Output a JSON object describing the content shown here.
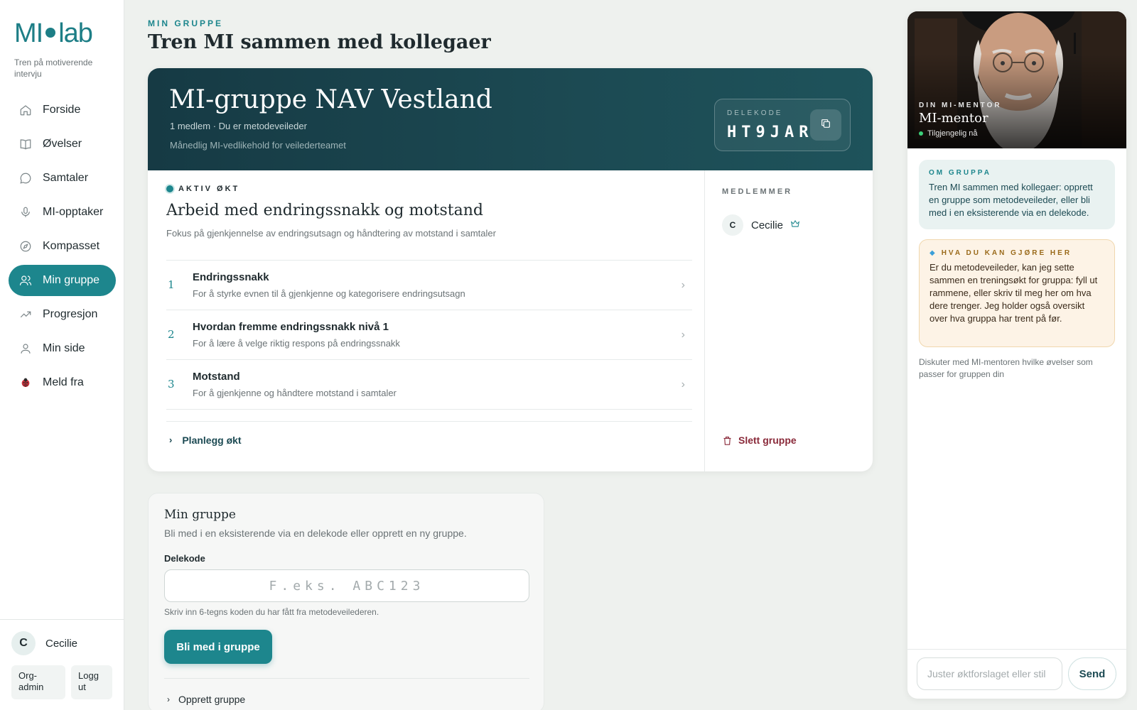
{
  "brand": {
    "logo_left": "MI",
    "logo_right": "lab",
    "tagline": "Tren på motiverende intervju"
  },
  "nav": {
    "items": [
      {
        "label": "Forside",
        "icon": "home-icon"
      },
      {
        "label": "Øvelser",
        "icon": "book-icon"
      },
      {
        "label": "Samtaler",
        "icon": "chat-icon"
      },
      {
        "label": "MI-opptaker",
        "icon": "microphone-icon"
      },
      {
        "label": "Kompasset",
        "icon": "compass-icon"
      },
      {
        "label": "Min gruppe",
        "icon": "users-icon",
        "active": true
      },
      {
        "label": "Progresjon",
        "icon": "trend-icon"
      },
      {
        "label": "Min side",
        "icon": "user-icon"
      },
      {
        "label": "Meld fra",
        "icon": "ladybug-icon"
      }
    ]
  },
  "user": {
    "initial": "C",
    "name": "Cecilie",
    "org_admin": "Org-admin",
    "logout": "Logg ut"
  },
  "header": {
    "eyebrow": "MIN GRUPPE",
    "title": "Tren MI sammen med kollegaer"
  },
  "group": {
    "name": "MI-gruppe NAV Vestland",
    "meta": "1 medlem · Du er metodeveileder",
    "description": "Månedlig MI-vedlikehold for veilederteamet",
    "code_label": "DELEKODE",
    "code": "HT9JAR"
  },
  "session": {
    "tag": "AKTIV ØKT",
    "title": "Arbeid med endringssnakk og motstand",
    "description": "Fokus på gjenkjennelse av endringsutsagn og håndtering av motstand i samtaler",
    "exercises": [
      {
        "num": "1",
        "title": "Endringssnakk",
        "subtitle": "For å styrke evnen til å gjenkjenne og kategorisere endringsutsagn"
      },
      {
        "num": "2",
        "title": "Hvordan fremme endringssnakk nivå 1",
        "subtitle": "For å lære å velge riktig respons på endringssnakk"
      },
      {
        "num": "3",
        "title": "Motstand",
        "subtitle": "For å gjenkjenne og håndtere motstand i samtaler"
      }
    ],
    "plan_label": "Planlegg økt"
  },
  "members": {
    "label": "MEDLEMMER",
    "list": [
      {
        "initial": "C",
        "name": "Cecilie"
      }
    ],
    "delete_label": "Slett gruppe"
  },
  "join": {
    "title": "Min gruppe",
    "description": "Bli med i en eksisterende via en delekode eller opprett en ny gruppe.",
    "field_label": "Delekode",
    "placeholder": "F.eks. ABC123",
    "hint": "Skriv inn 6-tegns koden du har fått fra metodeveilederen.",
    "button": "Bli med i gruppe",
    "create_label": "Opprett gruppe"
  },
  "mentor": {
    "eyebrow": "DIN MI-MENTOR",
    "name": "MI-mentor",
    "status": "Tilgjengelig nå",
    "about_title": "OM GRUPPA",
    "about_text": "Tren MI sammen med kollegaer: opprett en gruppe som metodeveileder, eller bli med i en eksisterende via en delekode.",
    "todo_title": "HVA DU KAN GJØRE HER",
    "todo_text": "Er du metodeveileder, kan jeg sette sammen en treningsøkt for gruppa: fyll ut rammene, eller skriv til meg her om hva dere trenger. Jeg holder også oversikt over hva gruppa har trent på før.",
    "hint": "Diskuter med MI-mentoren hvilke øvelser som passer for gruppen din",
    "input_placeholder": "Juster øktforslaget eller stil",
    "send": "Send"
  },
  "colors": {
    "accent": "#1d868d",
    "hero": "#163a44",
    "danger": "#8a2a3a",
    "warning_bg": "#fdf3e6"
  }
}
